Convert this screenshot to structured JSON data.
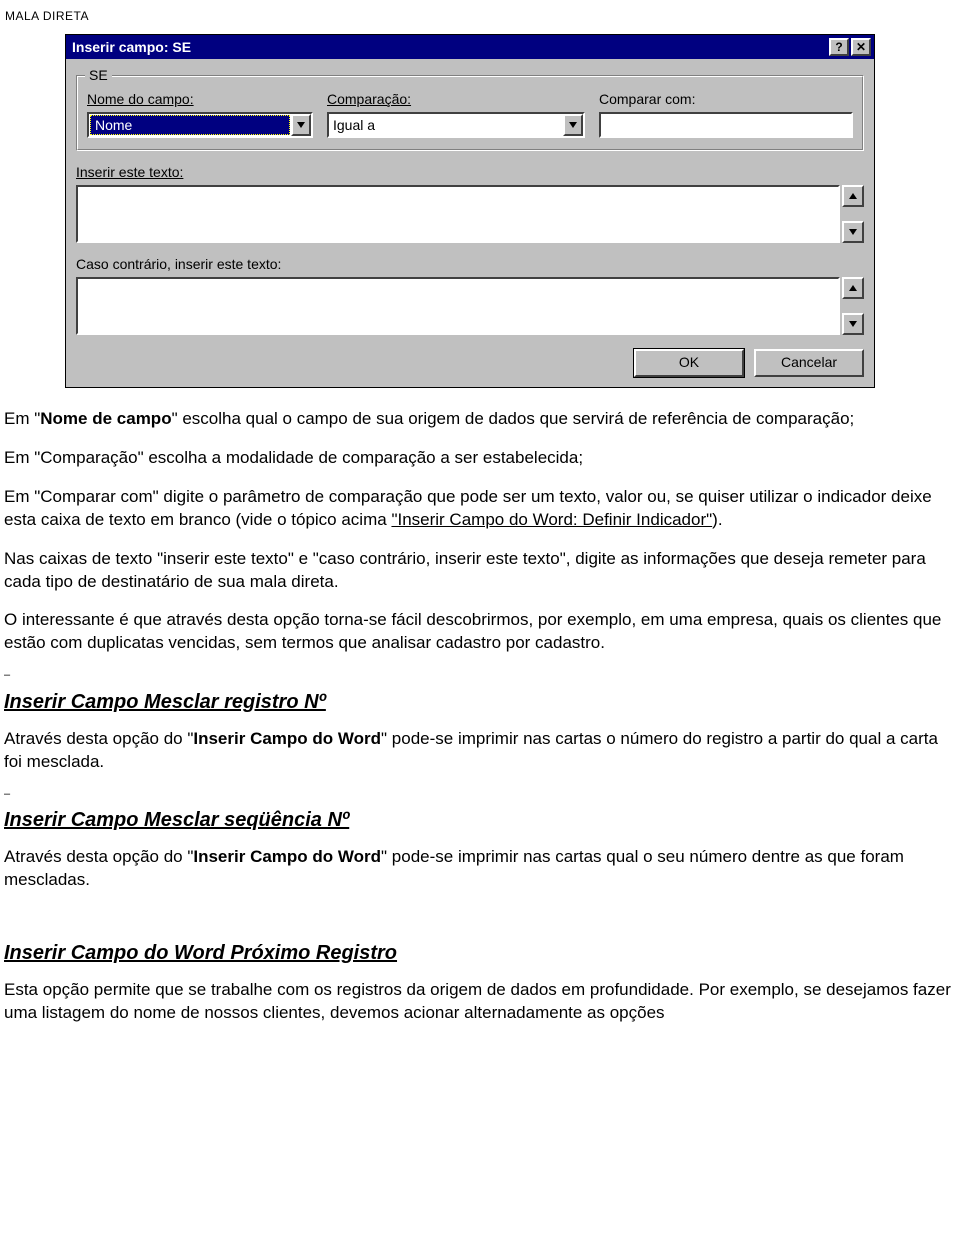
{
  "header": "MALA DIRETA",
  "dialog": {
    "title": "Inserir campo: SE",
    "help_glyph": "?",
    "close_glyph": "✕",
    "group_label": "SE",
    "field_label": "Nome do campo:",
    "field_value": "Nome",
    "comparison_label": "Comparação:",
    "comparison_value": "Igual a",
    "compare_with_label": "Comparar com:",
    "compare_with_value": "",
    "insert_text_label": "Inserir este texto:",
    "otherwise_label": "Caso contrário, inserir este texto:",
    "ok_label": "OK",
    "cancel_label": "Cancelar"
  },
  "body": {
    "p1a": "Em \"",
    "p1b": "Nome de campo",
    "p1c": "\" escolha qual o campo de sua origem de dados que servirá de referência de comparação;",
    "p2": "Em \"Comparação\" escolha a modalidade de comparação a ser estabelecida;",
    "p3a": "Em \"Comparar com\" digite o parâmetro de comparação que pode ser um texto, valor ou, se quiser utilizar o indicador deixe esta caixa de texto em branco (vide o tópico acima ",
    "p3b": "\"Inserir Campo do Word: Definir Indicador\"",
    "p3c": ").",
    "p4": "Nas caixas de texto \"inserir este texto\" e \"caso contrário, inserir este texto\", digite as informações que deseja remeter para cada tipo de destinatário de sua mala direta.",
    "p5": "O interessante é que através desta opção torna-se fácil descobrirmos, por exemplo, em uma empresa, quais os clientes que estão com duplicatas vencidas, sem termos que analisar cadastro por cadastro.",
    "h1": "Inserir Campo Mesclar registro Nº",
    "p6a": "Através desta opção do \"",
    "p6b": "Inserir Campo do Word",
    "p6c": "\" pode-se imprimir nas cartas o número do registro a partir do qual a carta foi mesclada.",
    "h2": "Inserir Campo Mesclar seqüência Nº",
    "p7a": "Através desta opção do \"",
    "p7b": "Inserir Campo do Word",
    "p7c": "\" pode-se imprimir nas cartas qual o seu número dentre as que foram mescladas.",
    "h3": "Inserir Campo do Word Próximo Registro",
    "p8": "Esta opção permite que se trabalhe com os registros da origem de dados em profundidade. Por exemplo, se desejamos fazer uma listagem do nome de nossos clientes, devemos acionar alternadamente as opções"
  }
}
